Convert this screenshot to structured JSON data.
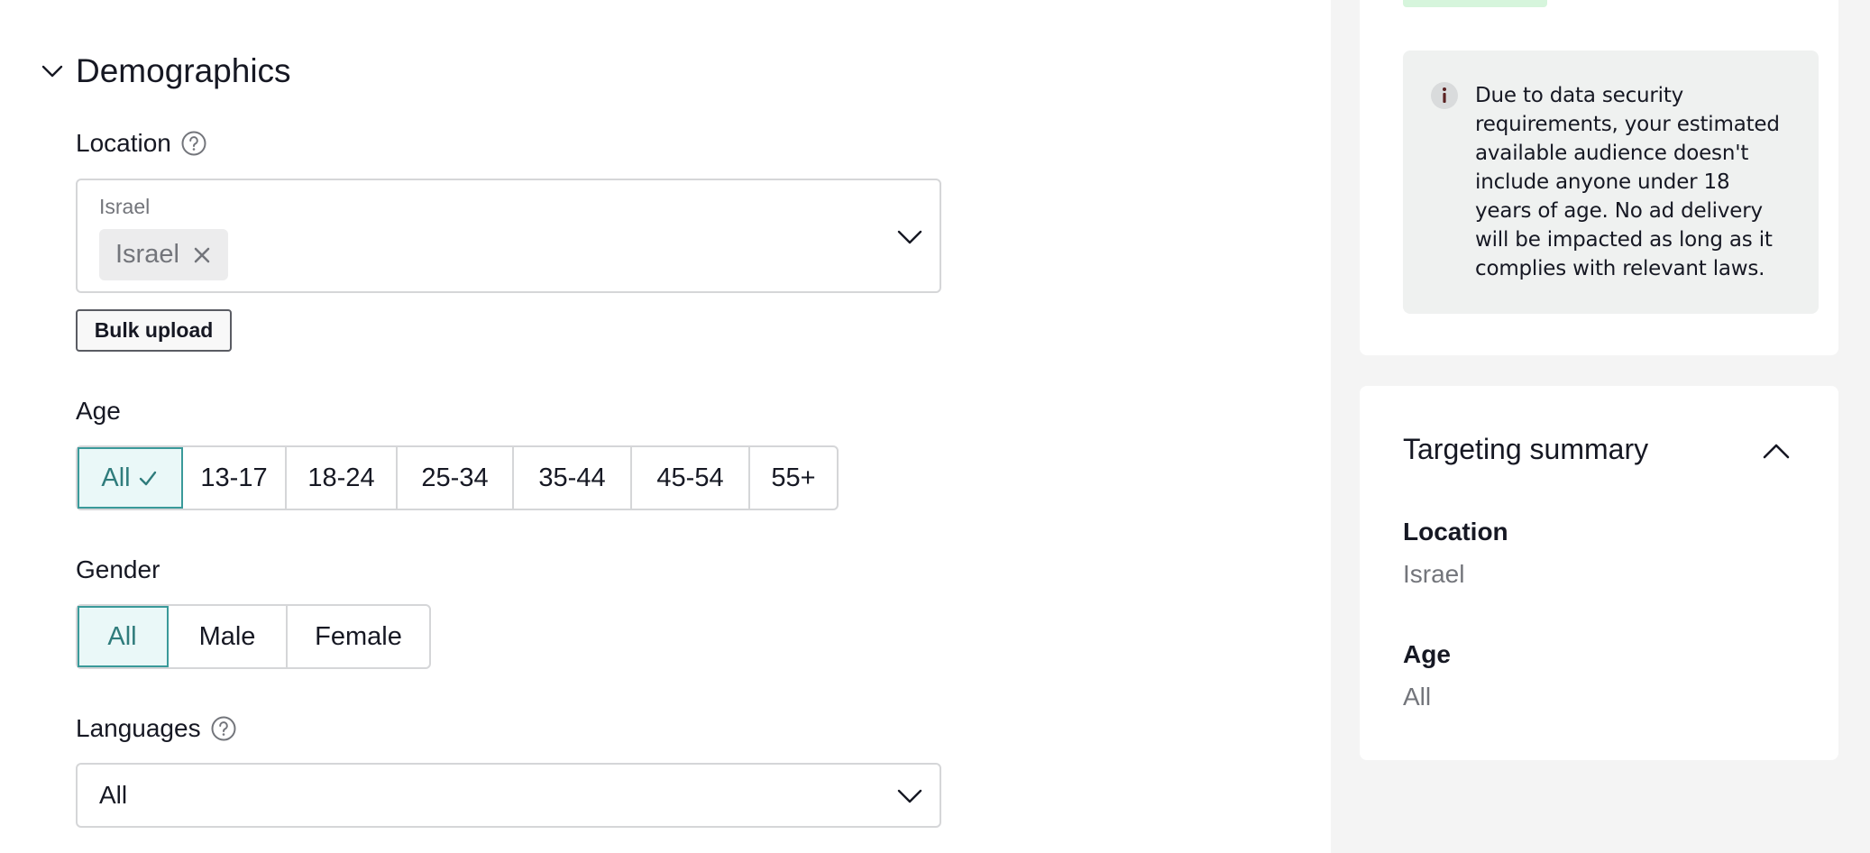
{
  "demographics": {
    "title": "Demographics",
    "location": {
      "label": "Location",
      "placeholder": "Israel",
      "selected_tag": "Israel",
      "bulk_upload_label": "Bulk upload"
    },
    "age": {
      "label": "Age",
      "options": [
        "All",
        "13-17",
        "18-24",
        "25-34",
        "35-44",
        "45-54",
        "55+"
      ],
      "selected": "All"
    },
    "gender": {
      "label": "Gender",
      "options": [
        "All",
        "Male",
        "Female"
      ],
      "selected": "All"
    },
    "languages": {
      "label": "Languages",
      "value": "All"
    }
  },
  "sidebar": {
    "info_notice": "Due to data security requirements, your estimated available audience doesn't include anyone under 18 years of age. No ad delivery will be impacted as long as it complies with relevant laws.",
    "summary": {
      "title": "Targeting summary",
      "location_label": "Location",
      "location_value": "Israel",
      "age_label": "Age",
      "age_value": "All"
    }
  },
  "colors": {
    "accent": "#2f7c7c",
    "accent_bg": "#eaf8f8",
    "muted_text": "#73757b",
    "sidebar_bg": "#f4f4f4",
    "info_bg": "#eff1f0"
  },
  "icons": {
    "section_toggle": "chevron-down-icon",
    "help": "question-circle-icon",
    "tag_remove": "close-icon",
    "dropdown": "chevron-down-icon",
    "selected": "check-icon",
    "info": "info-icon",
    "summary_toggle": "chevron-up-icon"
  }
}
